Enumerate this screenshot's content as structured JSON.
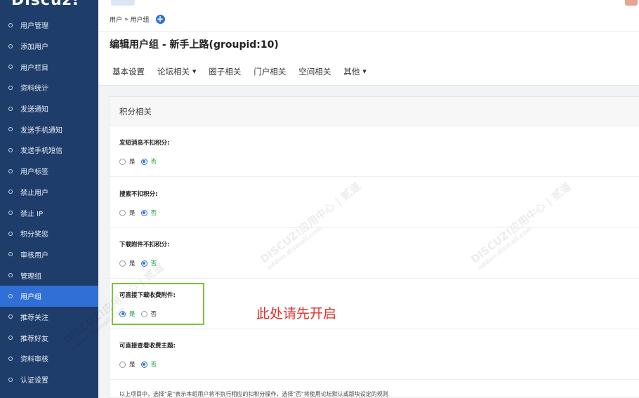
{
  "logo": {
    "text": "Discuz!"
  },
  "sidebar": {
    "items": [
      {
        "label": "用户管理"
      },
      {
        "label": "添加用户"
      },
      {
        "label": "用户栏目"
      },
      {
        "label": "资料统计"
      },
      {
        "label": "发送通知"
      },
      {
        "label": "发送手机通知"
      },
      {
        "label": "发送手机短信"
      },
      {
        "label": "用户标签"
      },
      {
        "label": "禁止用户"
      },
      {
        "label": "禁止 IP"
      },
      {
        "label": "积分奖惩"
      },
      {
        "label": "审核用户"
      },
      {
        "label": "管理组"
      },
      {
        "label": "用户组"
      },
      {
        "label": "推荐关注"
      },
      {
        "label": "推荐好友"
      },
      {
        "label": "资料审核"
      },
      {
        "label": "认证设置"
      }
    ],
    "active_index": 13
  },
  "breadcrumb": {
    "root": "用户",
    "sep": "»",
    "current": "用户组",
    "add_icon": "+"
  },
  "page_title": "编辑用户组 - 新手上路(groupid:10)",
  "tabs": [
    {
      "label": "基本设置",
      "dropdown": ""
    },
    {
      "label": "论坛相关",
      "dropdown": "▼"
    },
    {
      "label": "圈子相关",
      "dropdown": ""
    },
    {
      "label": "门户相关",
      "dropdown": ""
    },
    {
      "label": "空间相关",
      "dropdown": ""
    },
    {
      "label": "其他",
      "dropdown": "▼"
    }
  ],
  "section": {
    "title": "积分相关",
    "rows": [
      {
        "label": "发短消息不扣积分:",
        "yes": "是",
        "no": "否",
        "selected": "no"
      },
      {
        "label": "搜索不扣积分:",
        "yes": "是",
        "no": "否",
        "selected": "no"
      },
      {
        "label": "下载附件不扣积分:",
        "yes": "是",
        "no": "否",
        "selected": "no"
      },
      {
        "label": "可直接下载收费附件:",
        "yes": "是",
        "no": "否",
        "selected": "yes"
      },
      {
        "label": "可直接查看收费主题:",
        "yes": "是",
        "no": "否",
        "selected": "no"
      }
    ],
    "footer_note": "以上项目中，选择\"是\"表示本组用户将不执行相应的扣积分操作，选择\"否\"将使用论坛默认或版块设定的规则"
  },
  "annotation": {
    "text": "此处请先开启",
    "color": "#e0302a"
  },
  "watermark": {
    "main": "DISCUZ!应用中心 | 贰道",
    "sub": "addon.dismall.com"
  },
  "colors": {
    "sidebar_bg": "#1f3d6b",
    "sidebar_active": "#2f6fd6",
    "highlight_border": "#7dc33a"
  }
}
